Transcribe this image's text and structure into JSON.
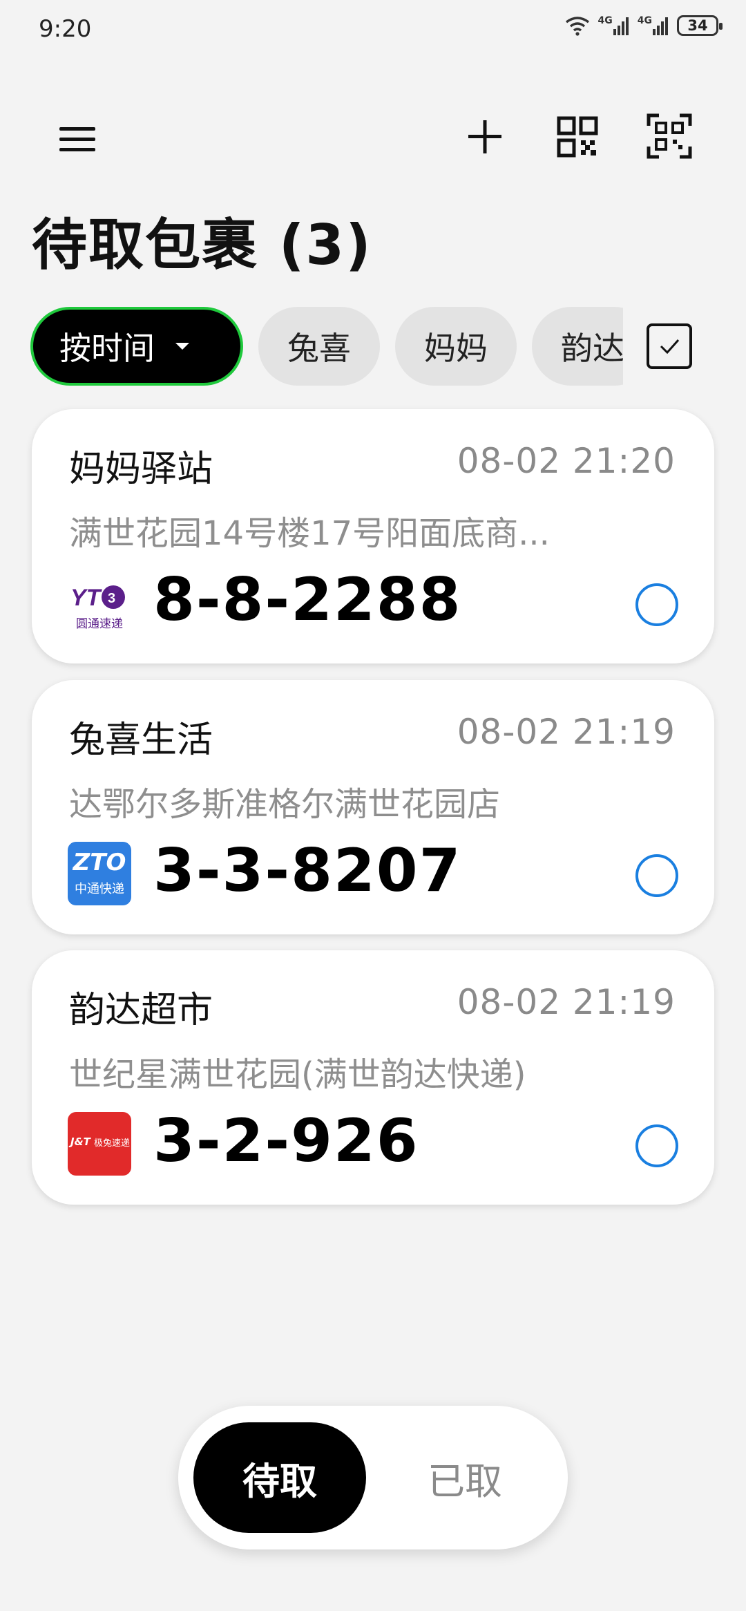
{
  "status_bar": {
    "time": "9:20",
    "network_1": "4G",
    "network_2": "4G",
    "battery": "34"
  },
  "toolbar": {
    "menu_icon": "menu-icon",
    "add_icon": "plus-icon",
    "qr_icon": "qr-code-icon",
    "scan_icon": "scan-icon"
  },
  "page_title": "待取包裹 (3)",
  "filters": {
    "sort_label": "按时间",
    "chips": [
      "兔喜",
      "妈妈",
      "韵达"
    ]
  },
  "parcels": [
    {
      "station": "妈妈驿站",
      "time": "08-02 21:20",
      "address": "满世花园14号楼17号阳面底商...",
      "carrier": "圆通速递",
      "carrier_logo_text": "YT",
      "pickup_code": "8-8-2288"
    },
    {
      "station": "兔喜生活",
      "time": "08-02 21:19",
      "address": "达鄂尔多斯准格尔满世花园店",
      "carrier": "中通快递",
      "carrier_logo_text": "ZTO",
      "pickup_code": "3-3-8207"
    },
    {
      "station": "韵达超市",
      "time": "08-02 21:19",
      "address": "世纪星满世花园(满世韵达快递)",
      "carrier": "极兔速递",
      "carrier_logo_text": "J&T",
      "pickup_code": "3-2-926"
    }
  ],
  "bottom_tabs": {
    "pending": "待取",
    "picked": "已取"
  },
  "colors": {
    "accent_green": "#1fc93c",
    "radio_blue": "#1a7fe0",
    "zto_blue": "#2f7fe0",
    "jt_red": "#e12a2a",
    "yto_purple": "#5b1f8a"
  }
}
